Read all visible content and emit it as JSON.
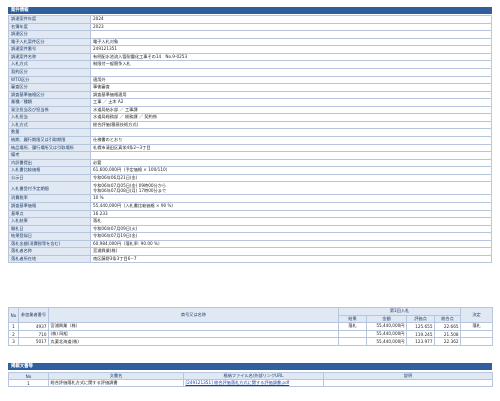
{
  "section1": {
    "title": "案件情報"
  },
  "info": [
    {
      "k": "調達案件年度",
      "v": "2024"
    },
    {
      "k": "名簿年度",
      "v": "2023"
    },
    {
      "k": "調達区分",
      "v": ""
    },
    {
      "k": "電子入札案件区分",
      "v": "電子入札対象"
    },
    {
      "k": "調達案件番号",
      "v": "249121351"
    },
    {
      "k": "調達案件名称",
      "v": "有明配水池流入管耐震化工事その14　No.9-0253"
    },
    {
      "k": "入札方式",
      "v": "制限付一般競争入札"
    },
    {
      "k": "契約区分",
      "v": ""
    },
    {
      "k": "WTO区分",
      "v": "適用外"
    },
    {
      "k": "審査区分",
      "v": "事後審査"
    },
    {
      "k": "調査基準価格区分",
      "v": "調査基準価格適用"
    },
    {
      "k": "業種／種類",
      "v": "工事 ／ 土木 A2"
    },
    {
      "k": "発注担当及び担当係",
      "v": "水道局給水部 ／ 工事課"
    },
    {
      "k": "入札担当",
      "v": "水道局総務部 ／ 総務課 ／ 契約係"
    },
    {
      "k": "入札方式",
      "v": "総合評価(簡易技術方式)"
    },
    {
      "k": "数量",
      "v": ""
    },
    {
      "k": "納期、履行期限又は引取期限",
      "v": "仕様書のとおり"
    },
    {
      "k": "納品場所、履行場所又は引取場所",
      "v": "札幌市清田区真栄4条2~3丁目"
    },
    {
      "k": "備考",
      "v": ""
    },
    {
      "k": "内訳書提出",
      "v": "必要"
    },
    {
      "k": "入札書比較価格",
      "v": "61,600,000円（予定価格 × 100/110）"
    },
    {
      "k": "公示日",
      "v": "令和06年06月21日(金)"
    },
    {
      "k": "入札書受付予定期間",
      "v": "令和06年07月05日(金) 09時00分から",
      "v2": "令和06年07月08日(月) 17時00分まで"
    },
    {
      "k": "消費税率",
      "v": "10 %"
    },
    {
      "k": "調査基準価格",
      "v": "55,440,000円（入札書比較価格 × 90 %）"
    },
    {
      "k": "基準点",
      "v": "16.233"
    },
    {
      "k": "入札結果",
      "v": "落札"
    },
    {
      "k": "開札日",
      "v": "令和06年07月09日(火)"
    },
    {
      "k": "結果登録日",
      "v": "令和06年07月19日(金)"
    },
    {
      "k": "落札金額(消費税等を含む)",
      "v": "60,984,000円（落札率: 90.00 %）"
    },
    {
      "k": "落札者名称",
      "v": "宮浦興業(株)"
    },
    {
      "k": "落札者所在地",
      "v": "南区藤野3条3丁目6−7"
    }
  ],
  "results": {
    "headers": {
      "no": "No",
      "bidder_no": "参加業者番号",
      "name": "商号又は名称",
      "round1": "第1回入札",
      "result": "結果",
      "amount": "金額",
      "score": "評価点",
      "total": "総合点",
      "decision": "決定"
    },
    "rows": [
      {
        "no": "1",
        "bidder": "4937",
        "name": "宮浦興業（株）",
        "result": "落札",
        "amount": "55,440,000円",
        "score": "125.655",
        "total": "22.665",
        "decision": "落札"
      },
      {
        "no": "2",
        "bidder": "710",
        "name": "(株) 岡組",
        "result": "",
        "amount": "55,440,000円",
        "score": "119.245",
        "total": "21.508",
        "decision": ""
      },
      {
        "no": "3",
        "bidder": "5017",
        "name": "丸薬北海道(株)",
        "result": "",
        "amount": "55,440,000円",
        "score": "123.977",
        "total": "22.362",
        "decision": ""
      }
    ]
  },
  "section2": {
    "title": "掲載文書等"
  },
  "docs": {
    "headers": {
      "no": "No",
      "doc": "文書名",
      "file": "格納ファイル名/外部リンクURL",
      "note": "説明"
    },
    "rows": [
      {
        "no": "1",
        "doc": "総合評価落札方式に関する評価調書",
        "file": "[249121351] 総合評価落札方式に関する評価調書.pdf",
        "note": ""
      }
    ]
  }
}
